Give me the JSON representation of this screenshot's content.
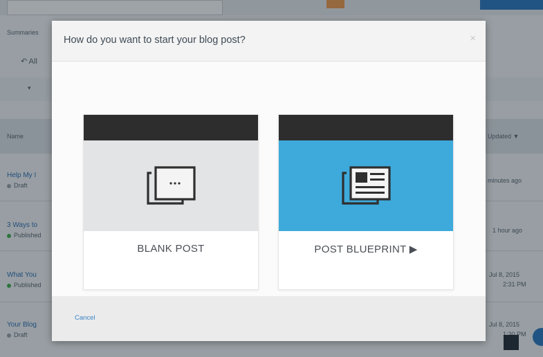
{
  "modal": {
    "title": "How do you want to start your blog post?",
    "close_glyph": "×",
    "cancel_label": "Cancel",
    "options": [
      {
        "label": "BLANK POST",
        "icon": "blank-document-icon"
      },
      {
        "label": "POST BLUEPRINT ▶",
        "icon": "newspaper-layout-icon"
      }
    ]
  },
  "background": {
    "toolbar_text": "Summaries",
    "back_link": "↶ All",
    "column_name": "Name",
    "column_updated": "Updated ▼",
    "posts": [
      {
        "title": "Help My I",
        "status": "Draft",
        "status_color": "#9aa3ab",
        "updated": "minutes ago"
      },
      {
        "title": "3 Ways to",
        "status": "Published",
        "status_color": "#3fae49",
        "updated": "1 hour ago"
      },
      {
        "title": "What You",
        "status": "Published",
        "status_color": "#3fae49",
        "updated": "Jul 8, 2015",
        "updated_time": "2:31 PM"
      },
      {
        "title": "Your Blog",
        "status": "Draft",
        "status_color": "#9aa3ab",
        "updated": "Jul 8, 2015",
        "updated_time": "1:30 PM"
      }
    ]
  },
  "colors": {
    "blueprint_accent": "#3eaadb",
    "card_topbar": "#2d2d2d",
    "link": "#3b84c8"
  }
}
